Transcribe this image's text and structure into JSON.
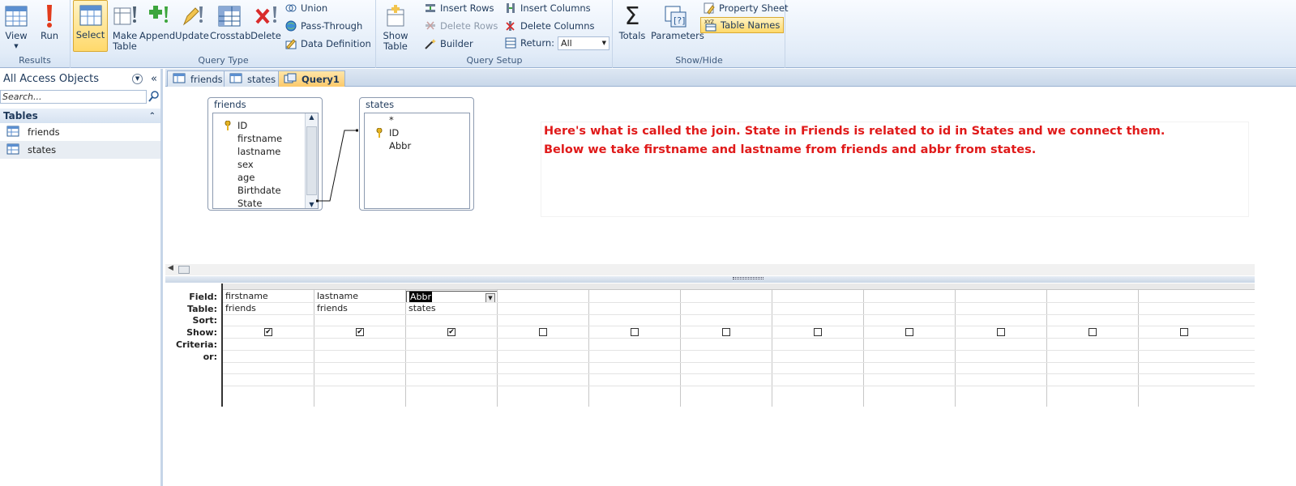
{
  "ribbon": {
    "results": {
      "label": "Results",
      "view": "View",
      "run": "Run"
    },
    "query_type": {
      "label": "Query Type",
      "select": "Select",
      "make_table": "Make\nTable",
      "append": "Append",
      "update": "Update",
      "crosstab": "Crosstab",
      "delete": "Delete",
      "union": "Union",
      "pass_through": "Pass-Through",
      "data_definition": "Data Definition"
    },
    "query_setup": {
      "label": "Query Setup",
      "show_table": "Show\nTable",
      "insert_rows": "Insert Rows",
      "delete_rows": "Delete Rows",
      "builder": "Builder",
      "insert_columns": "Insert Columns",
      "delete_columns": "Delete Columns",
      "return_label": "Return:",
      "return_value": "All"
    },
    "show_hide": {
      "label": "Show/Hide",
      "totals": "Totals",
      "parameters": "Parameters",
      "property_sheet": "Property Sheet",
      "table_names": "Table Names"
    }
  },
  "nav": {
    "title": "All Access Objects",
    "search_placeholder": "Search...",
    "section": "Tables",
    "items": [
      "friends",
      "states"
    ]
  },
  "tabs": [
    "friends",
    "states",
    "Query1"
  ],
  "tables": {
    "friends": {
      "title": "friends",
      "fields": [
        "ID",
        "firstname",
        "lastname",
        "sex",
        "age",
        "Birthdate",
        "State"
      ]
    },
    "states": {
      "title": "states",
      "fields": [
        "*",
        "ID",
        "Abbr"
      ]
    }
  },
  "note": {
    "line1": "Here's what is called the join. State in Friends is related to id in States and we connect them.",
    "line2": "Below we take firstname and lastname from friends and abbr from states."
  },
  "grid": {
    "row_labels": [
      "Field:",
      "Table:",
      "Sort:",
      "Show:",
      "Criteria:",
      "or:"
    ],
    "columns": [
      {
        "field": "firstname",
        "table": "friends",
        "show": true
      },
      {
        "field": "lastname",
        "table": "friends",
        "show": true
      },
      {
        "field": "Abbr",
        "table": "states",
        "show": true
      },
      {
        "field": "",
        "table": "",
        "show": false
      },
      {
        "field": "",
        "table": "",
        "show": false
      },
      {
        "field": "",
        "table": "",
        "show": false
      },
      {
        "field": "",
        "table": "",
        "show": false
      },
      {
        "field": "",
        "table": "",
        "show": false
      },
      {
        "field": "",
        "table": "",
        "show": false
      },
      {
        "field": "",
        "table": "",
        "show": false
      },
      {
        "field": "",
        "table": "",
        "show": false
      }
    ]
  },
  "colors": {
    "note_text": "#e01a1a",
    "active_button": "#ffd96b"
  }
}
